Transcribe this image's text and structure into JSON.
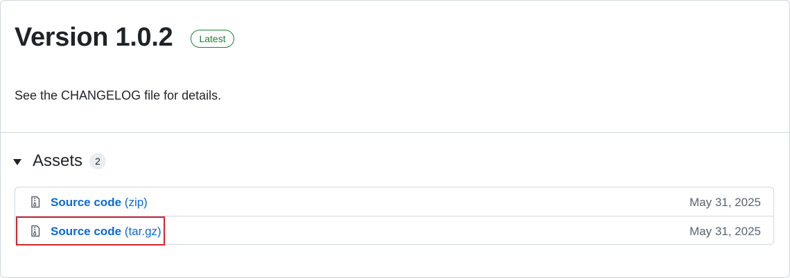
{
  "release": {
    "title": "Version 1.0.2",
    "badge": "Latest",
    "body": "See the CHANGELOG file for details."
  },
  "assets": {
    "title": "Assets",
    "count": "2",
    "items": [
      {
        "name": "Source code",
        "ext": "(zip)",
        "date": "May 31, 2025",
        "icon": "file-zip-icon"
      },
      {
        "name": "Source code",
        "ext": "(tar.gz)",
        "date": "May 31, 2025",
        "icon": "file-zip-icon"
      }
    ]
  },
  "colors": {
    "link": "#0969da",
    "badge": "#1a7f37",
    "highlight": "#d1242f",
    "border": "#d0d7de"
  }
}
